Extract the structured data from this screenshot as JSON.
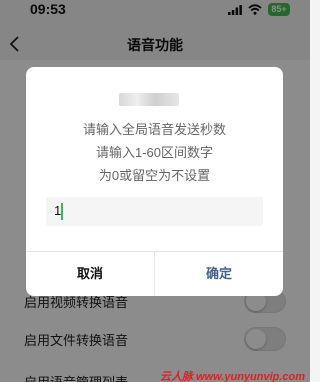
{
  "status_bar": {
    "time": "09:53",
    "battery": "85+"
  },
  "nav": {
    "title": "语音功能"
  },
  "settings": {
    "convert_video_label": "启用视频转换语音",
    "convert_file_label": "启用文件转换语音",
    "management_list_label": "启用语音管理列表"
  },
  "dialog": {
    "message_lines": [
      "请输入全局语音发送秒数",
      "请输入1-60区间数字",
      "为0或留空为不设置"
    ],
    "input_value": "1",
    "cancel_label": "取消",
    "confirm_label": "确定"
  },
  "watermark": "云人脉 www.yunyunvip.com",
  "colors": {
    "accent_green": "#2fbf58",
    "confirm_blue": "#46628f",
    "battery_green": "#3bc34d"
  }
}
